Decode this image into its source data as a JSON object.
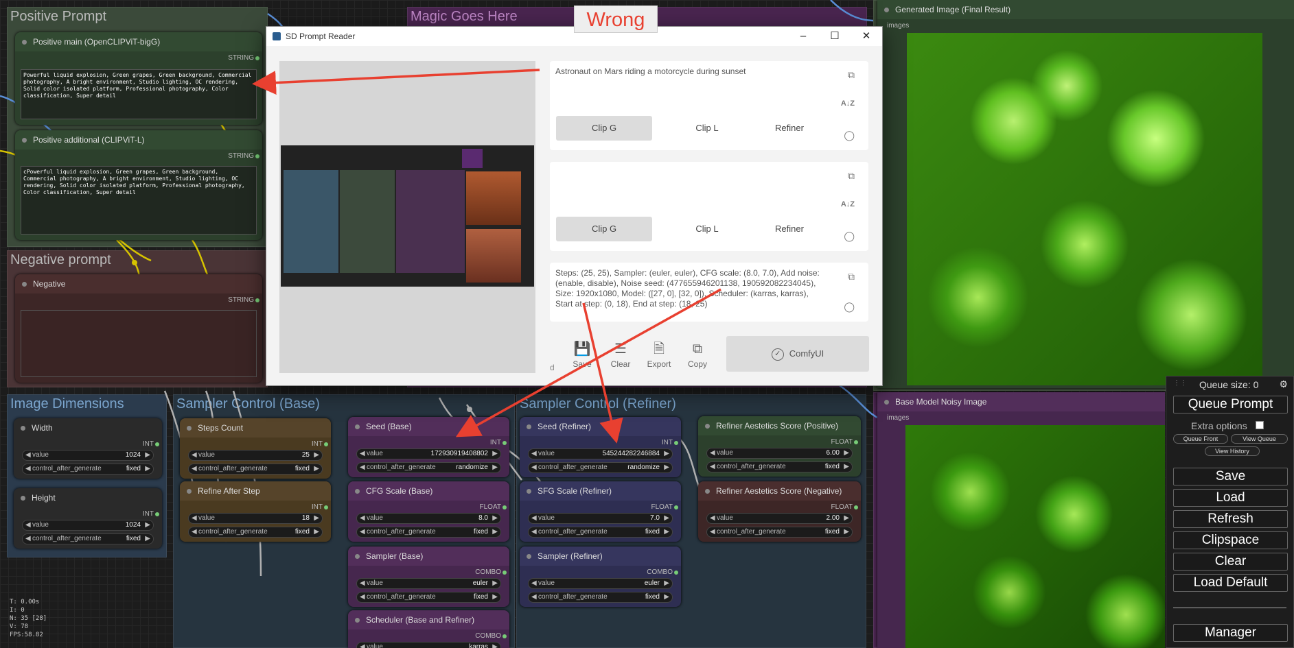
{
  "groups": {
    "positive": "Positive Prompt",
    "magic": "Magic Goes Here",
    "negative": "Negative prompt",
    "dimensions": "Image Dimensions",
    "sampler_base": "Sampler Control (Base)",
    "sampler_refiner": "Sampler Control (Refiner)"
  },
  "annotation": {
    "wrong_label": "Wrong"
  },
  "nodes": {
    "pos_main": {
      "title": "Positive main (OpenCLIPViT-bigG)",
      "out": "STRING",
      "text": "Powerful liquid explosion, Green grapes, Green background, Commercial photography, A bright environment, Studio lighting, OC rendering, Solid color isolated platform, Professional photography, Color classification, Super detail"
    },
    "pos_add": {
      "title": "Positive additional (CLIPViT-L)",
      "out": "STRING",
      "text": "cPowerful liquid explosion, Green grapes, Green background, Commercial photography, A bright environment, Studio lighting, OC rendering, Solid color isolated platform, Professional photography, Color classification, Super detail"
    },
    "negative": {
      "title": "Negative",
      "out": "STRING"
    },
    "width": {
      "title": "Width",
      "out": "INT",
      "value_label": "value",
      "value": "1024",
      "ctrl_label": "control_after_generate",
      "ctrl": "fixed"
    },
    "height": {
      "title": "Height",
      "out": "INT",
      "value_label": "value",
      "value": "1024",
      "ctrl_label": "control_after_generate",
      "ctrl": "fixed"
    },
    "steps": {
      "title": "Steps Count",
      "out": "INT",
      "value_label": "value",
      "value": "25",
      "ctrl_label": "control_after_generate",
      "ctrl": "fixed"
    },
    "refine_after": {
      "title": "Refine After Step",
      "out": "INT",
      "value_label": "value",
      "value": "18",
      "ctrl_label": "control_after_generate",
      "ctrl": "fixed"
    },
    "seed_base": {
      "title": "Seed (Base)",
      "out": "INT",
      "value_label": "value",
      "value": "172930919408802",
      "ctrl_label": "control_after_generate",
      "ctrl": "randomize"
    },
    "cfg_base": {
      "title": "CFG Scale (Base)",
      "out": "FLOAT",
      "value_label": "value",
      "value": "8.0",
      "ctrl_label": "control_after_generate",
      "ctrl": "fixed"
    },
    "sampler_base": {
      "title": "Sampler (Base)",
      "out": "COMBO",
      "value_label": "value",
      "value": "euler",
      "ctrl_label": "control_after_generate",
      "ctrl": "fixed"
    },
    "scheduler": {
      "title": "Scheduler (Base and Refiner)",
      "out": "COMBO",
      "value_label": "value",
      "value": "karras"
    },
    "seed_ref": {
      "title": "Seed (Refiner)",
      "out": "INT",
      "value_label": "value",
      "value": "545244282246884",
      "ctrl_label": "control_after_generate",
      "ctrl": "randomize"
    },
    "sfg_ref": {
      "title": "SFG Scale (Refiner)",
      "out": "FLOAT",
      "value_label": "value",
      "value": "7.0",
      "ctrl_label": "control_after_generate",
      "ctrl": "fixed"
    },
    "sampler_ref": {
      "title": "Sampler (Refiner)",
      "out": "COMBO",
      "value_label": "value",
      "value": "euler",
      "ctrl_label": "control_after_generate",
      "ctrl": "fixed"
    },
    "aest_pos": {
      "title": "Refiner Aestetics Score (Positive)",
      "out": "FLOAT",
      "value_label": "value",
      "value": "6.00",
      "ctrl_label": "control_after_generate",
      "ctrl": "fixed"
    },
    "aest_neg": {
      "title": "Refiner Aestetics Score (Negative)",
      "out": "FLOAT",
      "value_label": "value",
      "value": "2.00",
      "ctrl_label": "control_after_generate",
      "ctrl": "fixed"
    },
    "gen_img": {
      "title": "Generated Image (Final Result)",
      "input": "images"
    },
    "noisy_img": {
      "title": "Base Model Noisy Image",
      "input": "images"
    }
  },
  "dialog": {
    "title": "SD Prompt Reader",
    "positive_text": "Astronaut on Mars riding a motorcycle during sunset",
    "negative_text": "",
    "settings_text": "Steps: (25, 25), Sampler: (euler, euler), CFG scale: (8.0, 7.0), Add noise: (enable, disable), Noise seed: (477655946201138, 190592082234045), Size: 1920x1080, Model: ([27, 0], [32, 0]), Scheduler: (karras, karras), Start at step: (0, 18), End at step: (18, 25)",
    "tabs": [
      "Clip G",
      "Clip L",
      "Refiner"
    ],
    "buttons": {
      "edit": "d",
      "save": "Save",
      "clear": "Clear",
      "export": "Export",
      "copy": "Copy",
      "comfyui": "ComfyUI"
    }
  },
  "stats": {
    "t": "T: 0.00s",
    "i": "I: 0",
    "n": "N: 35 [28]",
    "v": "V: 78",
    "fps": "FPS:58.82"
  },
  "menu": {
    "queue_size": "Queue size: 0",
    "queue_prompt": "Queue Prompt",
    "extra_options": "Extra options",
    "queue_front": "Queue Front",
    "view_queue": "View Queue",
    "view_history": "View History",
    "save": "Save",
    "load": "Load",
    "refresh": "Refresh",
    "clipspace": "Clipspace",
    "clear": "Clear",
    "load_default": "Load Default",
    "manager": "Manager"
  }
}
